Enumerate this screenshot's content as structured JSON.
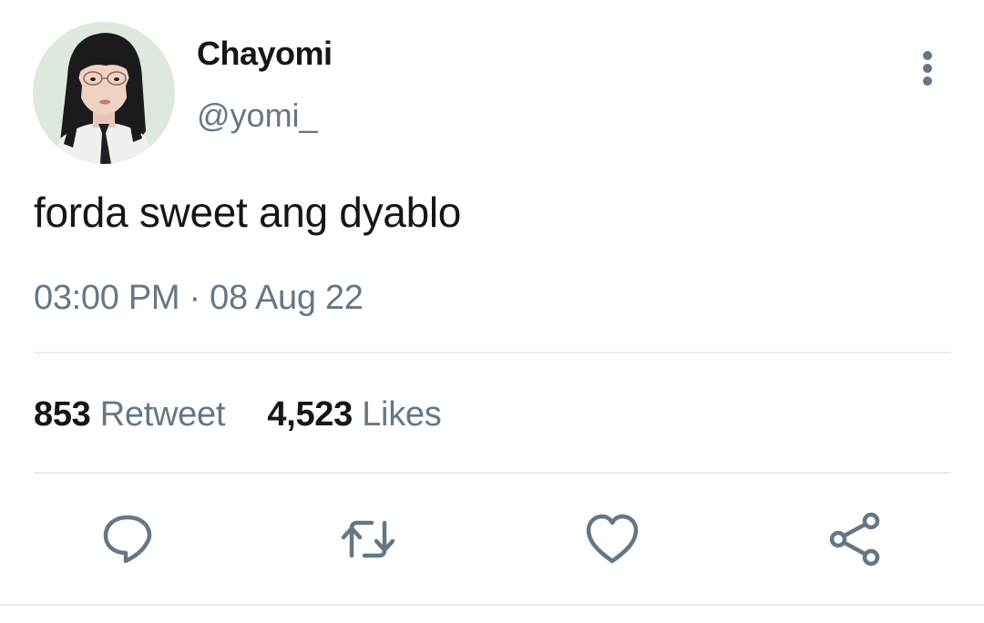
{
  "tweet": {
    "display_name": "Chayomi",
    "handle": "@yomi_",
    "text": "forda sweet ang dyablo",
    "timestamp": "03:00 PM · 08 Aug 22",
    "stats": {
      "retweets_count": "853",
      "retweets_label": "Retweet",
      "likes_count": "4,523",
      "likes_label": "Likes"
    },
    "actions": {
      "reply_icon": "speech-bubble",
      "retweet_icon": "retweet-arrows",
      "like_icon": "heart",
      "share_icon": "share-nodes"
    },
    "more_icon": "vertical-ellipsis"
  },
  "colors": {
    "text_primary": "#14171a",
    "text_secondary": "#657786",
    "divider": "#e6ecf0"
  }
}
